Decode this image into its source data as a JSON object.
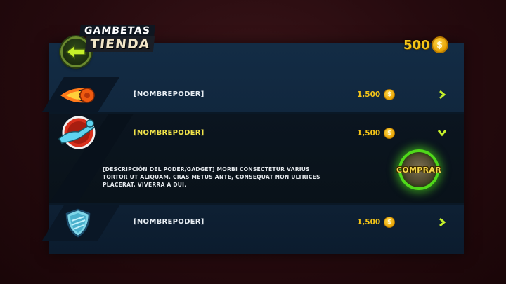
{
  "header": {
    "brand_small": "GAMBETAS",
    "brand_main": "TIENDA",
    "back_icon": "arrow-left-icon"
  },
  "wallet": {
    "coins": "500",
    "coin_icon": "$"
  },
  "items": [
    {
      "name": "[NOMBREPODER]",
      "price": "1,500",
      "coin_icon": "$",
      "icon": "fireball-icon",
      "state": "collapsed"
    },
    {
      "name": "[NOMBREPODER]",
      "price": "1,500",
      "coin_icon": "$",
      "icon": "flying-player-icon",
      "state": "expanded",
      "description": "[DESCRIPCIÓN DEL PODER/GADGET] MORBI CONSECTETUR VARIUS TORTOR UT ALIQUAM. CRAS METUS ANTE, CONSEQUAT NON ULTRICES PLACERAT, VIVERRA A DUI.",
      "buy_label": "COMPRAR"
    },
    {
      "name": "[NOMBREPODER]",
      "price": "1,500",
      "coin_icon": "$",
      "icon": "shield-icon",
      "state": "collapsed"
    }
  ],
  "colors": {
    "accent": "#c6f02a",
    "price": "#f5c518",
    "selected_name": "#f2e44a",
    "panel": "#132c45"
  }
}
